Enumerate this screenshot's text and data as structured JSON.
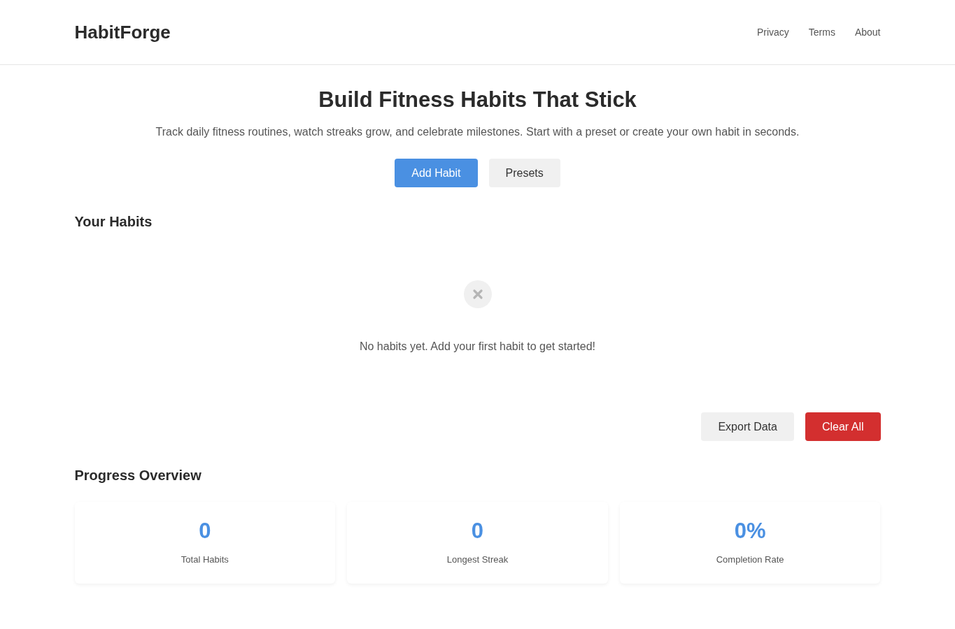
{
  "header": {
    "logo": "HabitForge",
    "nav": [
      "Privacy",
      "Terms",
      "About"
    ]
  },
  "hero": {
    "title": "Build Fitness Habits That Stick",
    "subtitle": "Track daily fitness routines, watch streaks grow, and celebrate milestones. Start with a preset or create your own habit in seconds.",
    "buttons": [
      {
        "label": "Add Habit",
        "kind": "primary"
      },
      {
        "label": "Presets",
        "kind": "secondary"
      }
    ]
  },
  "habits": {
    "title": "Your Habits",
    "empty_message": "No habits yet. Add your first habit to get started!",
    "actions": [
      {
        "label": "Export Data",
        "kind": "secondary"
      },
      {
        "label": "Clear All",
        "kind": "danger"
      }
    ]
  },
  "progress": {
    "title": "Progress Overview",
    "stats": [
      {
        "value": "0",
        "label": "Total Habits"
      },
      {
        "value": "0",
        "label": "Longest Streak"
      },
      {
        "value": "0%",
        "label": "Completion Rate"
      }
    ]
  }
}
